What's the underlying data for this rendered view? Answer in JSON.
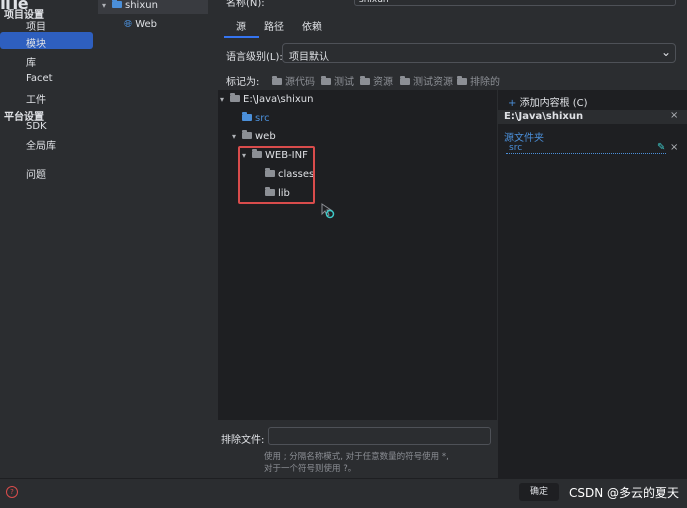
{
  "nav": {
    "group_project": "项目设置",
    "items_project": [
      "项目",
      "模块",
      "库",
      "Facet",
      "工件"
    ],
    "group_platform": "平台设置",
    "items_platform": [
      "SDK",
      "全局库"
    ],
    "problems": "问题",
    "selected": "模块"
  },
  "modules": {
    "root": "shixun",
    "child": "Web"
  },
  "main": {
    "name_label": "名称(N):",
    "name_value": "shixun",
    "tabs": [
      "源",
      "路径",
      "依赖"
    ],
    "active_tab": "源",
    "lang_label": "语言级别(L):",
    "lang_value": "项目默认",
    "mark_label": "标记为:",
    "mark_options": [
      "源代码",
      "测试",
      "资源",
      "测试资源",
      "排除的"
    ]
  },
  "tree": {
    "root": "E:\\Java\\shixun",
    "nodes": [
      "src",
      "web",
      "WEB-INF",
      "classes",
      "lib"
    ]
  },
  "right_panel": {
    "add_root": "添加内容根 (C)",
    "path": "E:\\Java\\shixun",
    "source_header": "源文件夹",
    "source_item": "src"
  },
  "exclude": {
    "label": "排除文件:",
    "value": "",
    "hint_line1": "使用 ; 分隔名称模式, 对于任意数量的符号使用 *,",
    "hint_line2": "对于一个符号则使用 ?。"
  },
  "footer": {
    "ok": "确定",
    "watermark": "CSDN @多云的夏天"
  },
  "colors": {
    "accent": "#3574f0",
    "highlight_box": "#d94c4c",
    "background": "#2b2d30",
    "panel": "#1e1f22",
    "source_blue": "#4b8fd9"
  }
}
